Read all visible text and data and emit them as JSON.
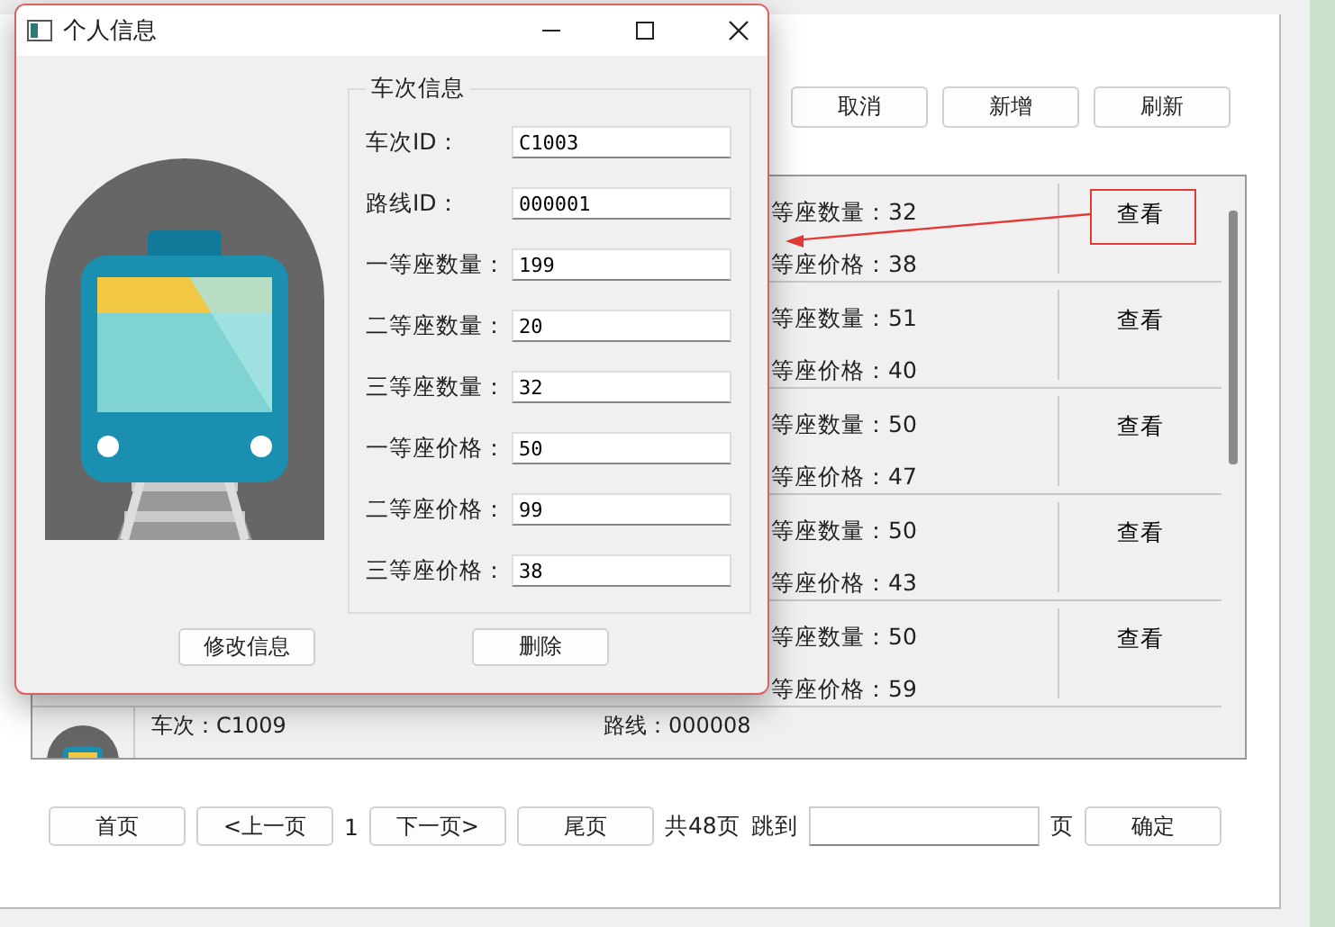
{
  "toolbar": {
    "buttons": [
      "取消",
      "新增",
      "刷新"
    ]
  },
  "list": {
    "rows": [
      {
        "seat_count": "等座数量：32",
        "seat_price": "等座价格：38",
        "action": "查看",
        "annotated": true
      },
      {
        "seat_count": "等座数量：51",
        "seat_price": "等座价格：40",
        "action": "查看",
        "annotated": false
      },
      {
        "seat_count": "等座数量：50",
        "seat_price": "等座价格：47",
        "action": "查看",
        "annotated": false
      },
      {
        "seat_count": "等座数量：50",
        "seat_price": "等座价格：43",
        "action": "查看",
        "annotated": false
      },
      {
        "seat_count": "等座数量：50",
        "seat_price": "等座价格：59",
        "action": "查看",
        "annotated": false
      }
    ],
    "partial_row": {
      "train": "车次：C1009",
      "route": "路线：000008"
    }
  },
  "pagination": {
    "first": "首页",
    "prev": "<上一页",
    "current": "1",
    "next": "下一页>",
    "last": "尾页",
    "total": "共48页",
    "jump_label": "跳到",
    "page_unit": "页",
    "confirm": "确定"
  },
  "dialog": {
    "title": "个人信息",
    "group_title": "车次信息",
    "fields": [
      {
        "label": "车次ID：",
        "value": "C1003"
      },
      {
        "label": "路线ID：",
        "value": "000001"
      },
      {
        "label": "一等座数量：",
        "value": "199"
      },
      {
        "label": "二等座数量：",
        "value": "20"
      },
      {
        "label": "三等座数量：",
        "value": "32"
      },
      {
        "label": "一等座价格：",
        "value": "50"
      },
      {
        "label": "二等座价格：",
        "value": "99"
      },
      {
        "label": "三等座价格：",
        "value": "38"
      }
    ],
    "buttons": [
      "修改信息",
      "删除"
    ]
  }
}
